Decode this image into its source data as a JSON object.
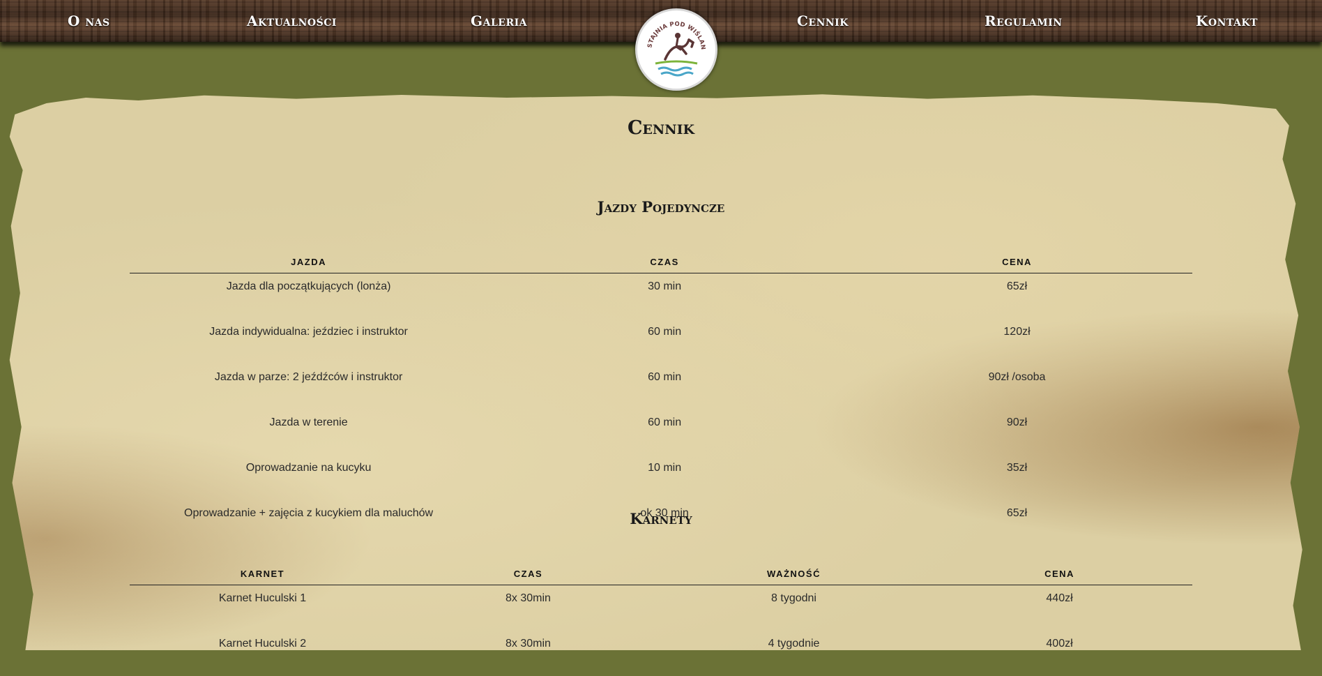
{
  "nav": {
    "items": [
      "O nas",
      "Aktualności",
      "Galeria",
      "Cennik",
      "Regulamin",
      "Kontakt"
    ]
  },
  "logo": {
    "text": "STAJNIA POD WIŚLANYM WAŁEM"
  },
  "page": {
    "title": "Cennik"
  },
  "section1": {
    "title": "Jazdy Pojedyncze",
    "headers": [
      "Jazda",
      "Czas",
      "Cena"
    ],
    "rows": [
      [
        "Jazda dla początkujących (lonża)",
        "30 min",
        "65zł"
      ],
      [
        "Jazda indywidualna: jeździec i instruktor",
        "60 min",
        "120zł"
      ],
      [
        "Jazda w parze: 2 jeźdźców i instruktor",
        "60 min",
        "90zł /osoba"
      ],
      [
        "Jazda w terenie",
        "60 min",
        "90zł"
      ],
      [
        "Oprowadzanie na kucyku",
        "10 min",
        "35zł"
      ],
      [
        "Oprowadzanie + zajęcia z kucykiem dla maluchów",
        "ok 30 min",
        "65zł"
      ]
    ]
  },
  "section2": {
    "title": "Karnety",
    "headers": [
      "Karnet",
      "Czas",
      "Ważność",
      "Cena"
    ],
    "rows": [
      [
        "Karnet Huculski 1",
        "8x 30min",
        "8 tygodni",
        "440zł"
      ],
      [
        "Karnet Huculski 2",
        "8x 30min",
        "4 tygodnie",
        "400zł"
      ]
    ]
  },
  "colors": {
    "background": "#6b7236",
    "parchment": "#dccfa3",
    "text": "#2a2a2a"
  }
}
